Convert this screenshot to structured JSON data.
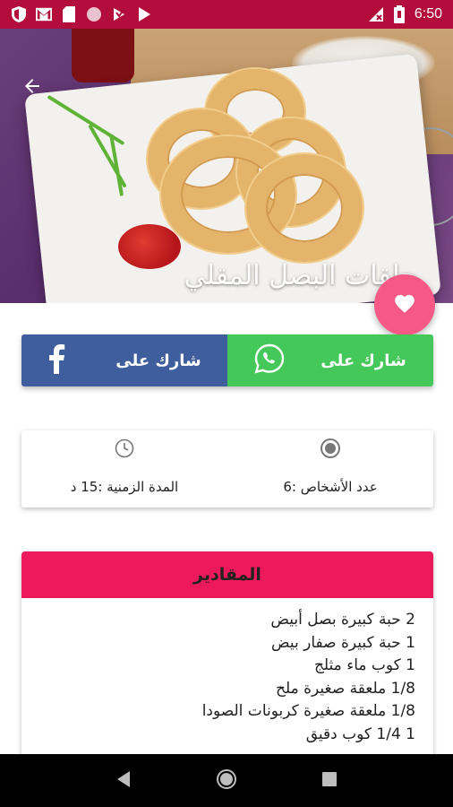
{
  "status_bar": {
    "time": "6:50",
    "left_icons": [
      "shield-icon",
      "gmail-icon",
      "sd-card-icon",
      "circle-icon",
      "download-icon",
      "play-store-icon"
    ],
    "right_icons": [
      "no-signal-icon",
      "battery-icon"
    ]
  },
  "hero": {
    "title": "حلقات البصل المقلي",
    "back_icon": "arrow-back-icon",
    "favorite_icon": "heart-icon"
  },
  "share": {
    "facebook_label": "شارك على",
    "whatsapp_label": "شارك على",
    "facebook_icon": "facebook-icon",
    "whatsapp_icon": "whatsapp-icon"
  },
  "info": {
    "time_label": "المدة الزمنية :15 د",
    "servings_label": "عدد الأشخاص :6",
    "time_icon": "clock-icon",
    "servings_icon": "radio-icon"
  },
  "ingredients": {
    "title": "المقادير",
    "items": [
      "2 حبة كبيرة بصل أبيض",
      "1 حبة كبيرة صفار بيض",
      "1 كوب ماء مثلج",
      "1/8 ملعقة صغيرة ملح",
      "1/8 ملعقة صغيرة كربونات الصودا",
      "1 1/4 كوب دقيق"
    ]
  },
  "nav": {
    "back_icon": "nav-back-icon",
    "home_icon": "nav-home-icon",
    "recents_icon": "nav-recents-icon"
  },
  "colors": {
    "status_bar": "#b30e3b",
    "accent_pink": "#ec1a5c",
    "favorite_pink": "#f55a86",
    "facebook_blue": "#3f5e9d",
    "whatsapp_green": "#45c85a"
  }
}
